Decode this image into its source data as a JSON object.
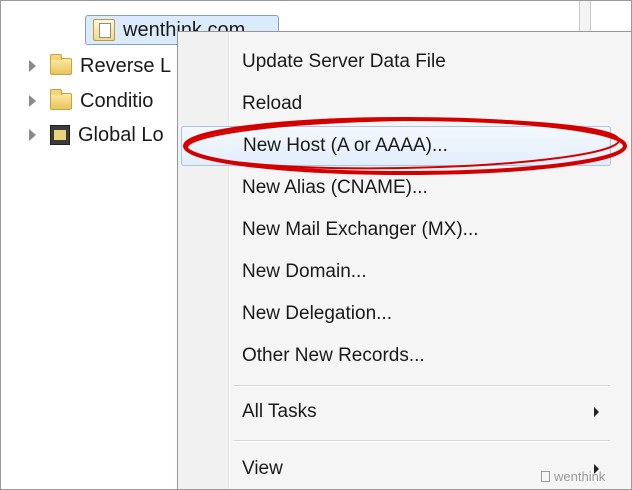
{
  "tree": {
    "selected_zone": "wenthink.com",
    "nodes": [
      {
        "label": "Reverse L",
        "icon": "folder-icon"
      },
      {
        "label": "Conditio",
        "icon": "folder-icon"
      },
      {
        "label": "Global Lo",
        "icon": "global-logging-icon"
      }
    ]
  },
  "context_menu": {
    "items": [
      {
        "label": "Update Server Data File"
      },
      {
        "label": "Reload"
      },
      {
        "label": "New Host (A or AAAA)...",
        "highlighted": true
      },
      {
        "label": "New Alias (CNAME)..."
      },
      {
        "label": "New Mail Exchanger (MX)..."
      },
      {
        "label": "New Domain..."
      },
      {
        "label": "New Delegation..."
      },
      {
        "label": "Other New Records..."
      },
      {
        "label": "All Tasks",
        "submenu": true
      },
      {
        "label": "View",
        "submenu": true
      }
    ]
  },
  "annotation": {
    "color": "#d40000"
  },
  "watermark": {
    "text": "wenthink"
  }
}
